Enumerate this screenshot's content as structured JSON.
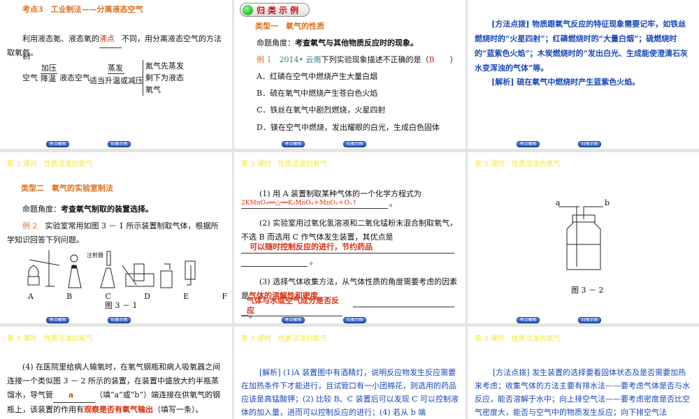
{
  "nav": {
    "prev": "考点聚焦",
    "next": "归类示例"
  },
  "lesson_title": "第 3 课时　性质活泼的氧气",
  "slide1": {
    "title": "考点3　工业制法——分离液态空气",
    "line1_a": "利用液态氮、液态氧的",
    "answer": "沸点",
    "line1_b": "不同，用分离液态空气的方法制",
    "line2": "取氧气。",
    "flow_air": "空气",
    "flow_step1_top": "加压",
    "flow_step1_bottom": "降温",
    "flow_liquid": "液态空气",
    "flow_step2_top": "蒸发",
    "flow_step2_bottom": "适当升温或减压",
    "result": [
      "氮气先蒸发",
      "剩下为液态",
      "氧气"
    ]
  },
  "slide2": {
    "header": "归类示例",
    "type": "类型一　氧气的性质",
    "angle_label": "命题角度：",
    "angle": "考查氧气与其他物质反应时的现象。",
    "example_label": "例 1",
    "example_source": "2014• 云南",
    "example_q": "下列实验现象描述不正确的是（",
    "answer": "B",
    "close": "）",
    "options": [
      "A．红磷在空气中燃烧产生大量白烟",
      "B．硫在氧气中燃烧产生苍白色火焰",
      "C．铁丝在氧气中剧烈燃烧，火星四射",
      "D．镁在空气中燃烧，发出耀眼的白光，生成白色固体"
    ]
  },
  "slide3": {
    "method": "[方法点拨] 物质跟氧气反应的特征现象需要记牢，如铁丝燃烧时的“火星四射”；红磷燃烧时的“大量白烟”；硫燃烧时的“蓝紫色火焰”；木炭燃烧时的“发出白光、生成能使澄清石灰水变浑浊的气体”等。",
    "analysis": "[解析] 硫在氧气中燃烧时产生蓝紫色火焰。"
  },
  "slide4": {
    "type": "类型二　氧气的实验室制法",
    "angle_label": "命题角度：",
    "angle": "考查氧气制取的装置选择。",
    "example_label": "例 2",
    "example_q": "实验室常用如图 3 － 1 所示装置制取气体，根据所学知识回答下列问题。",
    "syringe": "注射器",
    "labels": [
      "A",
      "B",
      "C",
      "D",
      "E",
      "F"
    ],
    "caption": "图 3 － 1"
  },
  "slide5": {
    "q1": "(1) 用 A 装置制取某种气体的一个化学方程式为",
    "a1": "2KMnO₄══△══K₂MnO₄＋MnO₂＋O₂↑",
    "q2": "(2) 实验室用过氧化氢溶液和二氧化锰粉末混合制取氧气，不选 B 而选用 C 作气体发生装置，其优点是",
    "a2": "可以随时控制反应的进行，节约药品",
    "q3": "(3) 选择气体收集方法，从气体性质的角度需要考虑的因素是",
    "a3a": "气体的溶解性和密度",
    "a3b": "气体与水或空气成分是否反应",
    "period": "。"
  },
  "slide6": {
    "a": "a",
    "b": "b",
    "caption": "图 3 － 2"
  },
  "slide7": {
    "q4": "(4) 在医院里给病人输氧时，在氧气钢瓶和病人吸氧器之间连接一个类似图 3 － 2  所示的装置，在装置中盛放大约半瓶蒸馏水，导气管",
    "a4a": "a",
    "q4b": "（填“a”或“b”）端连接在供氧气的钢瓶上，该装置的作用有",
    "a4b": "观察是否有氧气输出",
    "q4c": "（填写一条）。"
  },
  "slide8": {
    "analysis": "[解析] (1)A 装置图中有酒精灯，说明反应物发生反应需要在加热条件下才能进行，且试管口有一小团棉花，则选用的药品应该是高锰酸钾；(2) 比较 B、C 装置后可以发现 C 可以控制液体的加入量，进而可以控制反应的进行；(4) 若从 b 端"
  },
  "slide9": {
    "method": "[方法点拨] 发生装置的选择要看固体状态及是否需要加热来考虑；收集气体的方法主要有排水法——要考虑气体是否与水反应，能否溶解于水中；向上排空气法——要考虑密度是否比空气密度大，能否与空气中的物质发生反应；向下排空气法"
  }
}
